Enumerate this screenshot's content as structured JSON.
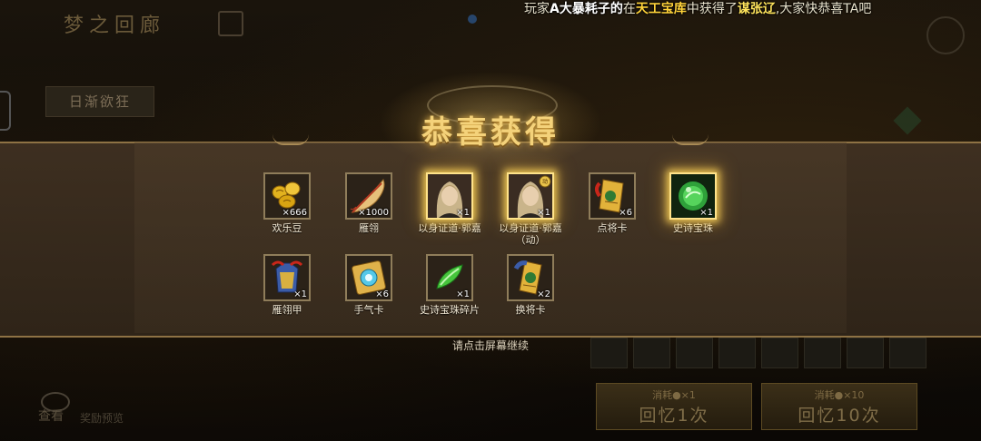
{
  "marquee": {
    "prefix": "玩家",
    "player": "A大暴耗子的",
    "mid1": "在",
    "place": "天工宝库",
    "mid2": "中获得了",
    "item": "谋张辽",
    "suffix": ",大家快恭喜TA吧"
  },
  "background": {
    "title": "梦之回廊",
    "left_button": "日渐欲狂",
    "view_label": "查看",
    "view_sub": "奖励预览",
    "btn_once": {
      "cost": "消耗●×1",
      "label": "回忆1次"
    },
    "btn_ten": {
      "cost": "消耗●×10",
      "label": "回忆10次"
    }
  },
  "reward": {
    "title": "恭喜获得",
    "continue_hint": "请点击屏幕继续",
    "row1": [
      {
        "name": "欢乐豆",
        "qty": "×666",
        "icon": "gold-beans-icon",
        "rare": false
      },
      {
        "name": "雁翎",
        "qty": "×1000",
        "icon": "feather-icon",
        "rare": false
      },
      {
        "name": "以身证道·郭嘉",
        "qty": "×1",
        "icon": "guojia-portrait-icon",
        "rare": true
      },
      {
        "name": "以身证道·郭嘉（动）",
        "qty": "×1",
        "icon": "guojia-animated-portrait-icon",
        "rare": true
      },
      {
        "name": "点将卡",
        "qty": "×6",
        "icon": "general-card-icon",
        "rare": false
      },
      {
        "name": "史诗宝珠",
        "qty": "×1",
        "icon": "epic-orb-icon",
        "rare": true
      }
    ],
    "row2": [
      {
        "name": "雁翎甲",
        "qty": "×1",
        "icon": "armor-icon",
        "rare": false
      },
      {
        "name": "手气卡",
        "qty": "×6",
        "icon": "luck-card-icon",
        "rare": false
      },
      {
        "name": "史诗宝珠碎片",
        "qty": "×1",
        "icon": "orb-shard-icon",
        "rare": false
      },
      {
        "name": "换将卡",
        "qty": "×2",
        "icon": "swap-general-card-icon",
        "rare": false
      }
    ]
  },
  "colors": {
    "gold": "#f4d27a",
    "rare_glow": "#ffe38a",
    "panel": "#40311f"
  }
}
